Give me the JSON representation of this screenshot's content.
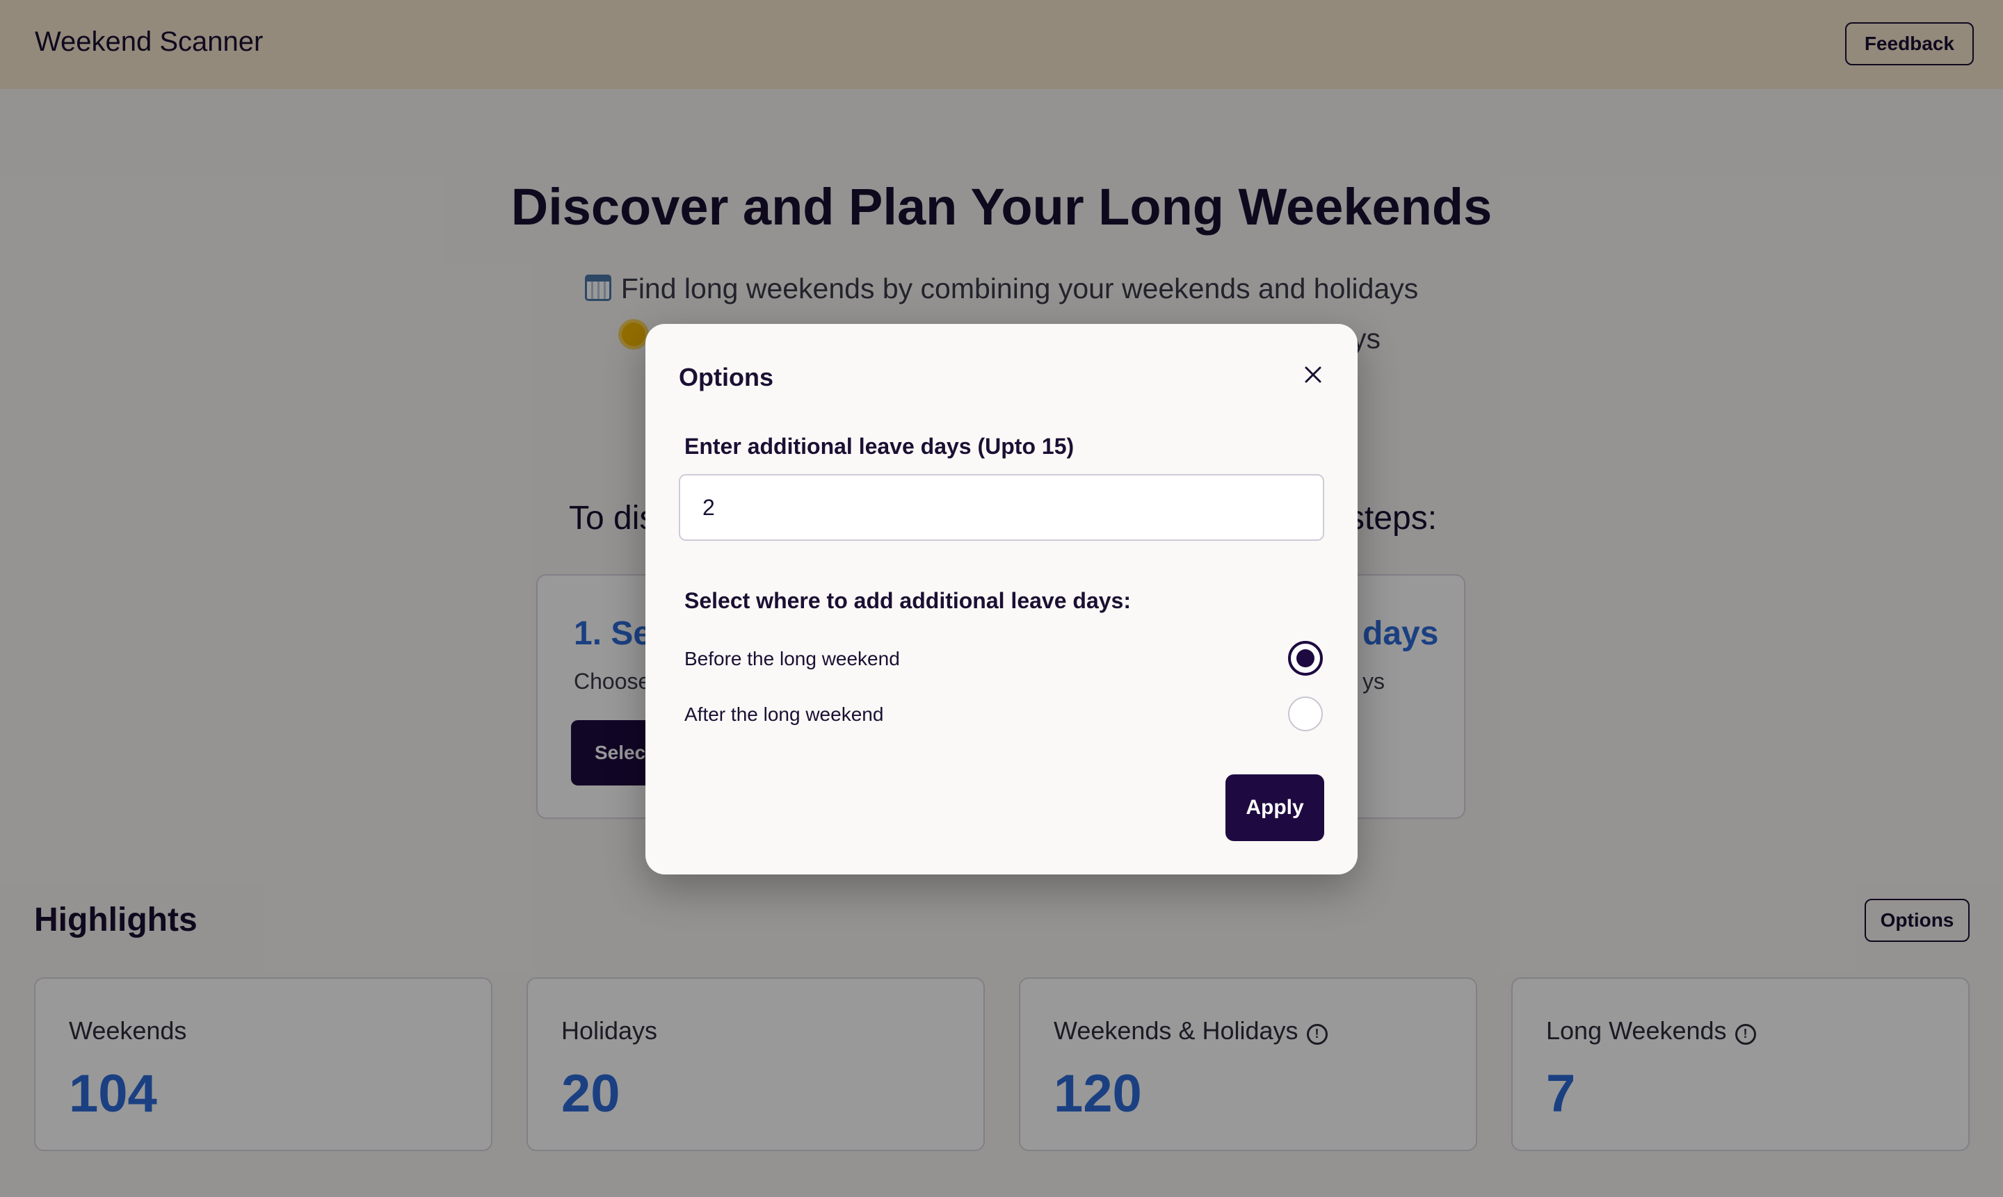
{
  "header": {
    "brand": "Weekend Scanner",
    "feedback_label": "Feedback"
  },
  "hero": {
    "title": "Discover and Plan Your Long Weekends",
    "line1": "Find long weekends by combining your weekends and holidays",
    "line1_icon": "calendar-icon",
    "line2_end": "ys",
    "line2_icon": "sun-icon"
  },
  "steps": {
    "intro_start": "To dis",
    "intro_end": "steps:",
    "card1": {
      "title": "1. Se",
      "desc": "Choose",
      "button": "Select"
    },
    "card2": {
      "title": "days",
      "desc": "ys"
    }
  },
  "highlights": {
    "title": "Highlights",
    "options_label": "Options",
    "stats": [
      {
        "label": "Weekends",
        "value": "104"
      },
      {
        "label": "Holidays",
        "value": "20"
      },
      {
        "label": "Weekends & Holidays",
        "value": "120"
      },
      {
        "label": "Long Weekends",
        "value": "7"
      }
    ]
  },
  "modal": {
    "title": "Options",
    "leave_label": "Enter additional leave days (Upto 15)",
    "leave_value": "2",
    "radio_heading": "Select where to add additional leave days:",
    "radio_options": [
      {
        "label": "Before the long weekend",
        "checked": true
      },
      {
        "label": "After the long weekend",
        "checked": false
      }
    ],
    "apply_label": "Apply"
  },
  "colors": {
    "accent": "#1e0a40",
    "stat_blue": "#2e6bd9",
    "header_bg": "#f6e6cf"
  }
}
